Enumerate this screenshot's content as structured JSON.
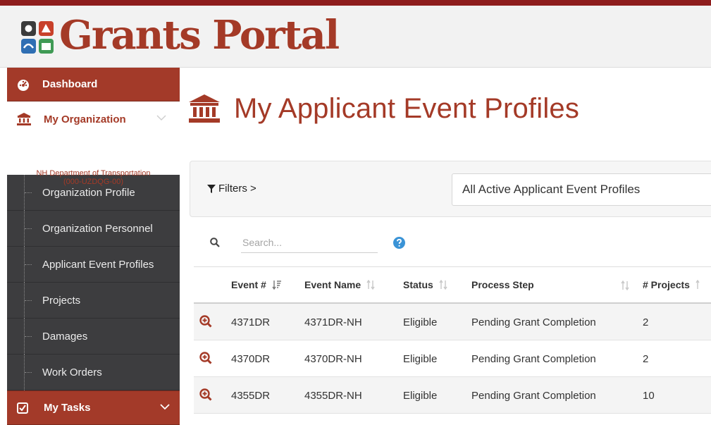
{
  "header": {
    "app_title": "Grants Portal"
  },
  "sidebar": {
    "dashboard": "Dashboard",
    "my_organization": "My Organization",
    "org_name_line1": "NH Department of Transportation",
    "org_name_line2": "(000-UZDQG-00)",
    "sub_items": [
      "Organization Profile",
      "Organization Personnel",
      "Applicant Event Profiles",
      "Projects",
      "Damages",
      "Work Orders"
    ],
    "my_tasks": "My Tasks"
  },
  "main": {
    "page_title": "My Applicant Event Profiles",
    "filters_label": "Filters >",
    "filter_selected": "All Active Applicant Event Profiles",
    "search_placeholder": "Search..."
  },
  "table": {
    "columns": [
      "Event #",
      "Event Name",
      "Status",
      "Process Step",
      "# Projects"
    ],
    "rows": [
      [
        "4371DR",
        "4371DR-NH",
        "Eligible",
        "Pending Grant Completion",
        "2"
      ],
      [
        "4370DR",
        "4370DR-NH",
        "Eligible",
        "Pending Grant Completion",
        "2"
      ],
      [
        "4355DR",
        "4355DR-NH",
        "Eligible",
        "Pending Grant Completion",
        "10"
      ]
    ]
  },
  "colors": {
    "brand_red": "#a43a27",
    "sidebar_dark": "#3d3d3f",
    "help_blue": "#3a93d6"
  }
}
